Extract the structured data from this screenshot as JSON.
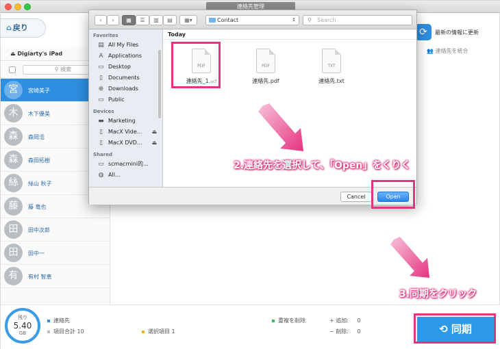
{
  "window": {
    "title": "連絡先管理"
  },
  "header": {
    "back_label": "戻り",
    "refresh_label": "最新の情報に更新",
    "merge_label": "連絡先を統合"
  },
  "sidebar": {
    "device": "Digiarty's iPad",
    "search_placeholder": "検索",
    "contacts": [
      {
        "initial": "宮",
        "name": "宮崎美子",
        "selected": true
      },
      {
        "initial": "木",
        "name": "木下優美",
        "selected": false
      },
      {
        "initial": "森",
        "name": "森岡浩",
        "selected": false
      },
      {
        "initial": "森",
        "name": "森田拓樹",
        "selected": false
      },
      {
        "initial": "絲",
        "name": "絲山 秋子",
        "selected": false
      },
      {
        "initial": "藤",
        "name": "藤 竜也",
        "selected": false
      },
      {
        "initial": "田",
        "name": "田中次郎",
        "selected": false
      },
      {
        "initial": "田",
        "name": "田中一",
        "selected": false
      },
      {
        "initial": "有",
        "name": "有村 智恵",
        "selected": false
      }
    ]
  },
  "storage": {
    "label": "残り",
    "value": "5.40",
    "unit": "GB"
  },
  "status": {
    "contacts_label": "連絡先",
    "total_label": "項目合計 10",
    "selected_label": "選択項目 1",
    "delete_dup_label": "重複を削除",
    "added_label": "追加:",
    "added_value": "0",
    "deleted_label": "削除:",
    "deleted_value": "0"
  },
  "sync_label": "同期",
  "dialog": {
    "location": "Contact",
    "search_placeholder": "Search",
    "section_today": "Today",
    "sidebar": {
      "favorites_header": "Favorites",
      "favorites": [
        "All My Files",
        "Applications",
        "Desktop",
        "Documents",
        "Downloads",
        "Public"
      ],
      "devices_header": "Devices",
      "devices": [
        "Marketing",
        "MacX Vide...",
        "MacX DVD..."
      ],
      "shared_header": "Shared",
      "shared": [
        "scmacmini的...",
        "All..."
      ]
    },
    "files": [
      {
        "ext": "PDF",
        "name": "連絡先_1.",
        "suffix": "vcf"
      },
      {
        "ext": "PDF",
        "name": "連絡先.pdf",
        "suffix": ""
      },
      {
        "ext": "TXT",
        "name": "連絡先.txt",
        "suffix": ""
      }
    ],
    "cancel_label": "Cancel",
    "open_label": "Open"
  },
  "annotations": {
    "step2": "2.連絡先を選択して、「Open」をくりく",
    "step3": "3.同期をクリック",
    "highlight_color": "#e5337f"
  },
  "colors": {
    "accent": "#2e8fe0",
    "highlight": "#e5337f"
  }
}
